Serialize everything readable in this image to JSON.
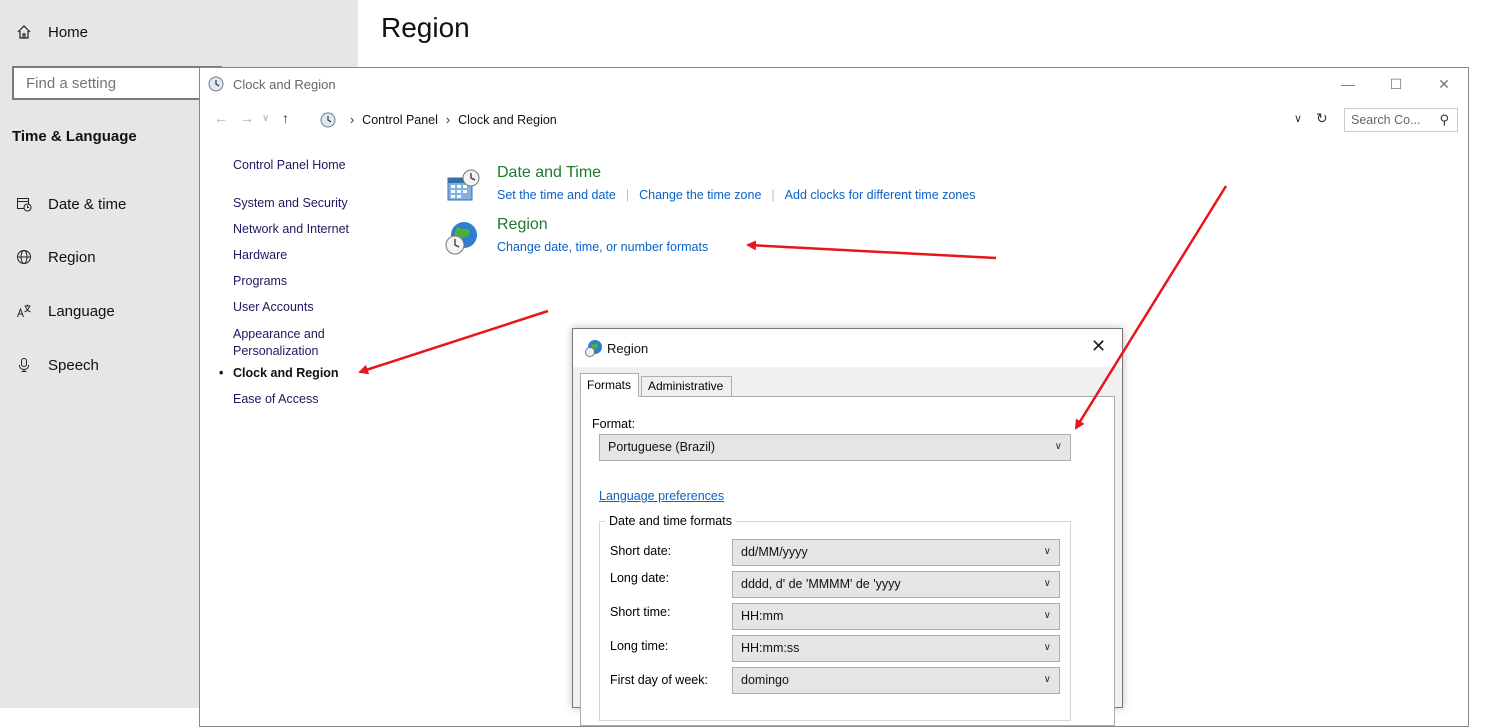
{
  "settings": {
    "home_label": "Home",
    "search_placeholder": "Find a setting",
    "section_title": "Time & Language",
    "nav": [
      {
        "label": "Date & time",
        "icon": "calendar-clock-icon"
      },
      {
        "label": "Region",
        "icon": "globe-icon"
      },
      {
        "label": "Language",
        "icon": "language-icon"
      },
      {
        "label": "Speech",
        "icon": "microphone-icon"
      }
    ],
    "page_title": "Region"
  },
  "control_panel": {
    "title": "Clock and Region",
    "breadcrumb": [
      "Control Panel",
      "Clock and Region"
    ],
    "search_placeholder": "Search Co...",
    "left_nav": {
      "home": "Control Panel Home",
      "items": [
        "System and Security",
        "Network and Internet",
        "Hardware",
        "Programs",
        "User Accounts",
        "Appearance and Personalization",
        "Clock and Region",
        "Ease of Access"
      ]
    },
    "categories": {
      "date_time": {
        "title": "Date and Time",
        "links": [
          "Set the time and date",
          "Change the time zone",
          "Add clocks for different time zones"
        ]
      },
      "region": {
        "title": "Region",
        "link": "Change date, time, or number formats"
      }
    }
  },
  "region_dialog": {
    "title": "Region",
    "tabs": [
      "Formats",
      "Administrative"
    ],
    "format_label": "Format:",
    "format_value": "Portuguese (Brazil)",
    "language_preferences": "Language preferences",
    "group_title": "Date and time formats",
    "rows": [
      {
        "label": "Short date:",
        "value": "dd/MM/yyyy"
      },
      {
        "label": "Long date:",
        "value": "dddd, d' de 'MMMM' de 'yyyy"
      },
      {
        "label": "Short time:",
        "value": "HH:mm"
      },
      {
        "label": "Long time:",
        "value": "HH:mm:ss"
      },
      {
        "label": "First day of week:",
        "value": "domingo"
      }
    ]
  },
  "colors": {
    "sidebar_bg": "#e6e6e6",
    "link_blue": "#0b62c4",
    "category_green": "#1e7a2e",
    "annotation_red": "#e8151b"
  }
}
